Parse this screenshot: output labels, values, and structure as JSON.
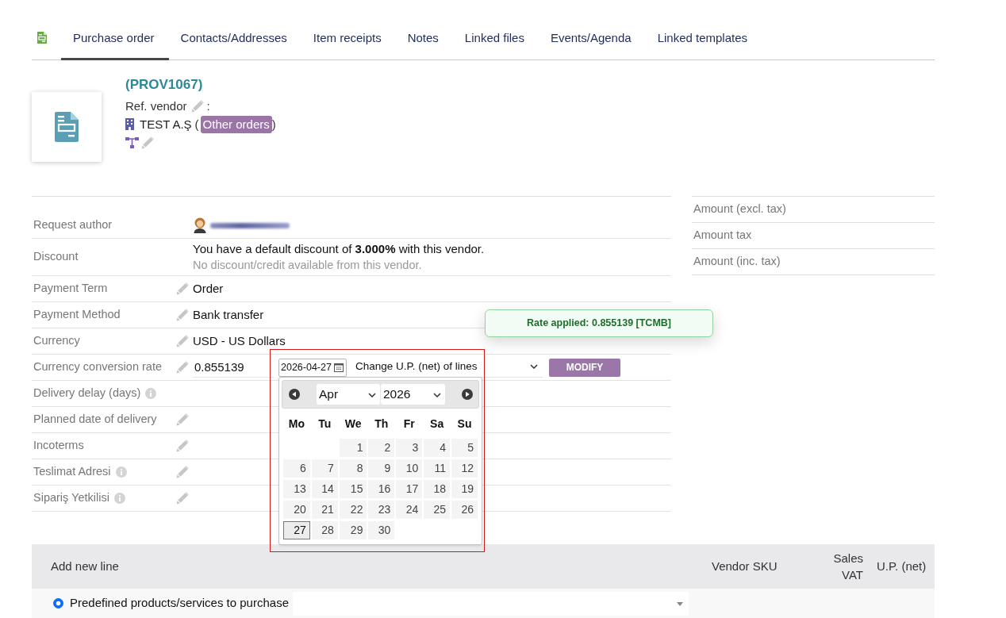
{
  "tabs": [
    {
      "label": "Purchase order",
      "selected": true
    },
    {
      "label": "Contacts/Addresses",
      "selected": false
    },
    {
      "label": "Item receipts",
      "selected": false
    },
    {
      "label": "Notes",
      "selected": false
    },
    {
      "label": "Linked files",
      "selected": false
    },
    {
      "label": "Events/Agenda",
      "selected": false
    },
    {
      "label": "Linked templates",
      "selected": false
    }
  ],
  "header": {
    "ref": "(PROV1067)",
    "ref_vendor_label": "Ref. vendor",
    "ref_vendor_separator": ":",
    "company": "TEST A.Ş",
    "paren_open": "(",
    "orders_link": "Other orders",
    "paren_close": ")"
  },
  "fields": [
    {
      "kind": "author",
      "label": "Request author",
      "info": false,
      "editable": false,
      "name_blurred": true
    },
    {
      "kind": "discount",
      "label": "Discount",
      "info": false,
      "editable": false,
      "value": "You have a default discount of **3.000%** with this vendor.",
      "note": "No discount/credit available from this vendor."
    },
    {
      "kind": "text",
      "label": "Payment Term",
      "info": false,
      "editable": true,
      "value": "Order"
    },
    {
      "kind": "text",
      "label": "Payment Method",
      "info": false,
      "editable": true,
      "value": "Bank transfer"
    },
    {
      "kind": "text",
      "label": "Currency",
      "info": false,
      "editable": true,
      "value": "USD - US Dollars"
    },
    {
      "kind": "rate",
      "label": "Currency conversion rate",
      "info": false,
      "editable": true,
      "value": "0.855139",
      "date": "2026-04-27",
      "action": "Change U.P. (net) of lines",
      "button": "MODIFY"
    },
    {
      "kind": "text",
      "label": "Delivery delay (days)",
      "info": true,
      "editable": false
    },
    {
      "kind": "text",
      "label": "Planned date of delivery",
      "info": false,
      "editable": true
    },
    {
      "kind": "text",
      "label": "Incoterms",
      "info": false,
      "editable": true
    },
    {
      "kind": "text",
      "label": "Teslimat Adresi",
      "info": true,
      "editable": true
    },
    {
      "kind": "text",
      "label": "Sipariş Yetkilisi",
      "info": true,
      "editable": true
    }
  ],
  "datepicker": {
    "open": true,
    "highlighted": true,
    "month": "Apr",
    "year": "2026",
    "weekdays": [
      "Mo",
      "Tu",
      "We",
      "Th",
      "Fr",
      "Sa",
      "Su"
    ],
    "weeks": [
      [
        {
          "day": "1",
          "selected": false
        },
        {
          "day": "2",
          "selected": false
        },
        {
          "day": "3",
          "selected": false
        },
        {
          "day": "4",
          "selected": false
        },
        {
          "day": "5",
          "selected": false
        }
      ],
      [
        {
          "day": "6",
          "selected": false
        },
        {
          "day": "7",
          "selected": false
        },
        {
          "day": "8",
          "selected": false
        },
        {
          "day": "9",
          "selected": false
        },
        {
          "day": "10",
          "selected": false
        },
        {
          "day": "11",
          "selected": false
        },
        {
          "day": "12",
          "selected": false
        }
      ],
      [
        {
          "day": "13",
          "selected": false
        },
        {
          "day": "14",
          "selected": false
        },
        {
          "day": "15",
          "selected": false
        },
        {
          "day": "16",
          "selected": false
        },
        {
          "day": "17",
          "selected": false
        },
        {
          "day": "18",
          "selected": false
        },
        {
          "day": "19",
          "selected": false
        }
      ],
      [
        {
          "day": "20",
          "selected": false
        },
        {
          "day": "21",
          "selected": false
        },
        {
          "day": "22",
          "selected": false
        },
        {
          "day": "23",
          "selected": false
        },
        {
          "day": "24",
          "selected": false
        },
        {
          "day": "25",
          "selected": false
        },
        {
          "day": "26",
          "selected": false
        }
      ],
      [
        {
          "day": "27",
          "selected": true
        },
        {
          "day": "28",
          "selected": false
        },
        {
          "day": "29",
          "selected": false
        },
        {
          "day": "30",
          "selected": false
        }
      ]
    ]
  },
  "toast": {
    "text": "Rate applied: 0.855139 [TCMB]"
  },
  "totals": [
    {
      "label": "Amount (excl. tax)"
    },
    {
      "label": "Amount tax"
    },
    {
      "label": "Amount (inc. tax)"
    }
  ],
  "lines_table": {
    "columns": [
      "Add new line",
      "Vendor SKU",
      "Sales VAT",
      "U.P. (net)"
    ]
  },
  "new_line": {
    "checked": true,
    "label": "Predefined products/services to purchase"
  }
}
